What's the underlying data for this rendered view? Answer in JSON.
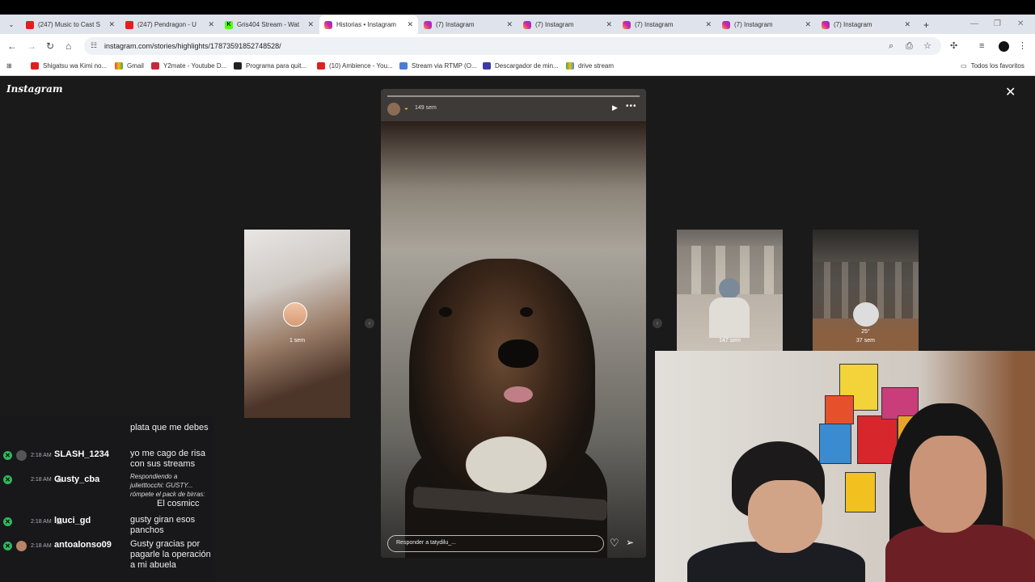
{
  "browser": {
    "tabs": [
      {
        "title": "(247) Music to Cast S",
        "favicon": "youtube-icon"
      },
      {
        "title": "(247) Pendragon - U",
        "favicon": "youtube-icon"
      },
      {
        "title": "Gris404 Stream - Wat",
        "favicon": "kick-icon"
      },
      {
        "title": "Historias • Instagram",
        "favicon": "instagram-icon",
        "active": true
      },
      {
        "title": "(7) Instagram",
        "favicon": "instagram-icon"
      },
      {
        "title": "(7) Instagram",
        "favicon": "instagram-icon"
      },
      {
        "title": "(7) Instagram",
        "favicon": "instagram-icon"
      },
      {
        "title": "(7) Instagram",
        "favicon": "instagram-icon"
      },
      {
        "title": "(7) Instagram",
        "favicon": "instagram-icon"
      }
    ],
    "new_tab": "+",
    "url": "instagram.com/stories/highlights/17873591852748528/",
    "bookmarks": [
      "Shigatsu wa Kimi no...",
      "Gmail",
      "Y2mate - Youtube D...",
      "Programa para quit...",
      "(10) Ambience - You...",
      "Stream via RTMP (O...",
      "Descargador de min...",
      "drive stream"
    ],
    "favorites_label": "Todos los favoritos"
  },
  "instagram": {
    "logo": "Instagram",
    "main_story": {
      "time": "149 sem",
      "reply_placeholder": "Responder a tatydilu_..."
    },
    "side_stories": [
      {
        "time": "1 sem"
      },
      {
        "time": "147 sem"
      },
      {
        "temp": "25°",
        "time": "37 sem"
      }
    ]
  },
  "chat": {
    "messages": [
      {
        "time": "",
        "user": "SLASH_1234",
        "text": "plata que me debes"
      },
      {
        "time": "2:18 AM",
        "user": "SLASH_1234",
        "text": "yo me cago de risa con sus streams"
      },
      {
        "time": "2:18 AM",
        "user": "Gusty_cba",
        "reply": "Respondiendo a julietttocchi: GUSTY... rómpete el pack de birras:",
        "text": "El cosmicc"
      },
      {
        "time": "2:18 AM",
        "user": "luuci_gd",
        "text": "gusty giran esos panchos"
      },
      {
        "time": "2:18 AM",
        "user": "antoalonso09",
        "text": "Gusty gracias por pagarle la operación a mi abuela"
      }
    ]
  }
}
